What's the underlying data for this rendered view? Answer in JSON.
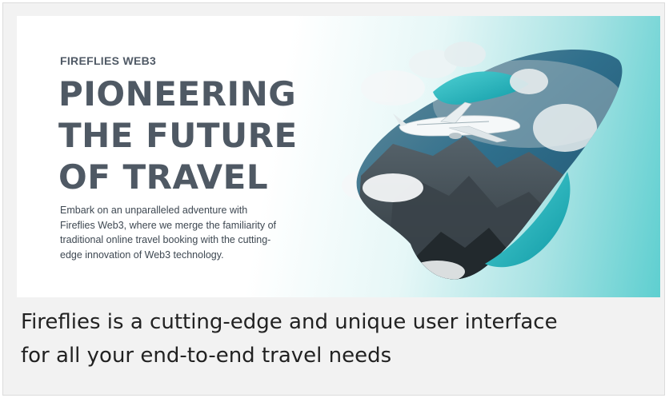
{
  "hero": {
    "eyebrow": "FIREFLIES WEB3",
    "headline": [
      "PIONEERING",
      "THE FUTURE",
      "OF TRAVEL"
    ],
    "body": [
      "Embark on an unparalleled adventure with",
      "Fireflies Web3, where we merge the familiarity of",
      "traditional online travel booking with the cutting-",
      "edge innovation of Web3 technology."
    ],
    "illustration": "airplane-over-mountain-coast"
  },
  "caption": [
    "Fireflies is a cutting-edge and unique user interface",
    "for all your end-to-end travel needs"
  ],
  "colors": {
    "accent": "#1cb5bd",
    "headline": "#4f5964",
    "background": "#f2f2f2"
  }
}
